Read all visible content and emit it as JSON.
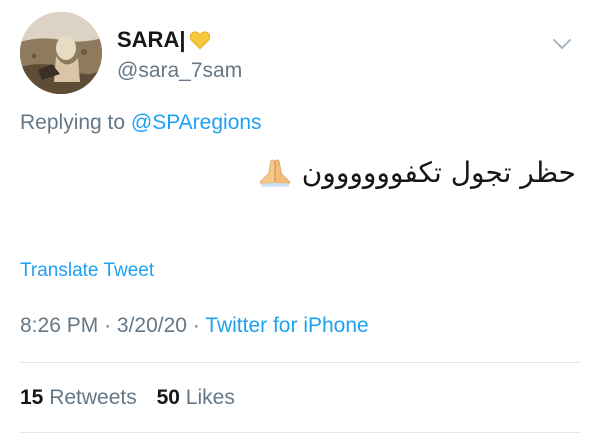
{
  "user": {
    "display_name": "SARA|",
    "handle": "@sara_7sam",
    "avatar_icon": "profile-photo",
    "badge_icon": "yellow-heart-icon"
  },
  "reply": {
    "prefix": "Replying to",
    "mention": "@SPAregions"
  },
  "tweet": {
    "text": "حظر تجول تكفوووووون",
    "emoji_icon": "folded-hands-icon"
  },
  "translate_label": "Translate Tweet",
  "meta": {
    "time": "8:26 PM",
    "separator": "·",
    "date": "3/20/20",
    "source": "Twitter for iPhone"
  },
  "stats": {
    "retweets_count": "15",
    "retweets_label": "Retweets",
    "likes_count": "50",
    "likes_label": "Likes"
  },
  "colors": {
    "accent": "#1da1f2",
    "secondary_text": "#657786",
    "primary_text": "#14171a",
    "divider": "#e1e8ed",
    "heart": "#f8c73a"
  }
}
